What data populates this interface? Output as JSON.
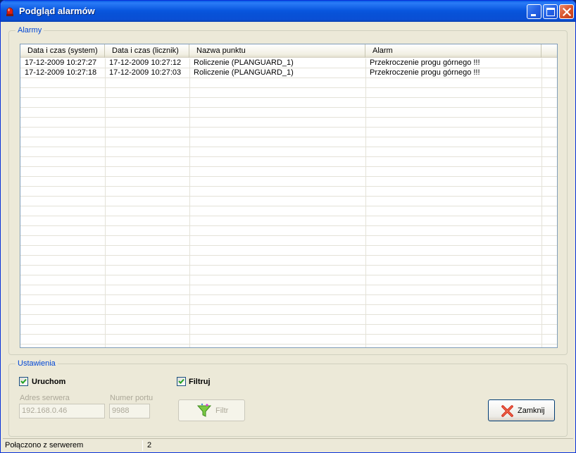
{
  "window": {
    "title": "Podgląd alarmów",
    "title_icon": "red-alarm-light-icon",
    "controls": [
      "minimize-icon",
      "maximize-icon",
      "close-icon"
    ]
  },
  "alarms_group": {
    "legend": "Alarmy",
    "columns": [
      "Data i czas (system)",
      "Data i czas (licznik)",
      "Nazwa punktu",
      "Alarm"
    ],
    "rows": [
      [
        "17-12-2009 10:27:27",
        "17-12-2009 10:27:12",
        "Roliczenie (PLANGUARD_1)",
        "Przekroczenie progu górnego !!!"
      ],
      [
        "17-12-2009 10:27:18",
        "17-12-2009 10:27:03",
        "Roliczenie (PLANGUARD_1)",
        "Przekroczenie progu górnego !!!"
      ]
    ]
  },
  "settings_group": {
    "legend": "Ustawienia",
    "run_checkbox": {
      "label": "Uruchom",
      "checked": true
    },
    "filter_checkbox": {
      "label": "Filtruj",
      "checked": true
    },
    "server_address": {
      "label": "Adres serwera",
      "value": "192.168.0.46"
    },
    "port_number": {
      "label": "Numer portu",
      "value": "9988"
    },
    "filter_button": {
      "label": "Filtr",
      "icon": "funnel-icon"
    },
    "close_button": {
      "label": "Zamknij",
      "icon": "red-x-icon"
    }
  },
  "statusbar": {
    "connection": "Połączono z serwerem",
    "count": "2"
  },
  "colors": {
    "accent": "#0046d5",
    "titlebar": "#0a58e0",
    "window_bg": "#ece9d8"
  }
}
